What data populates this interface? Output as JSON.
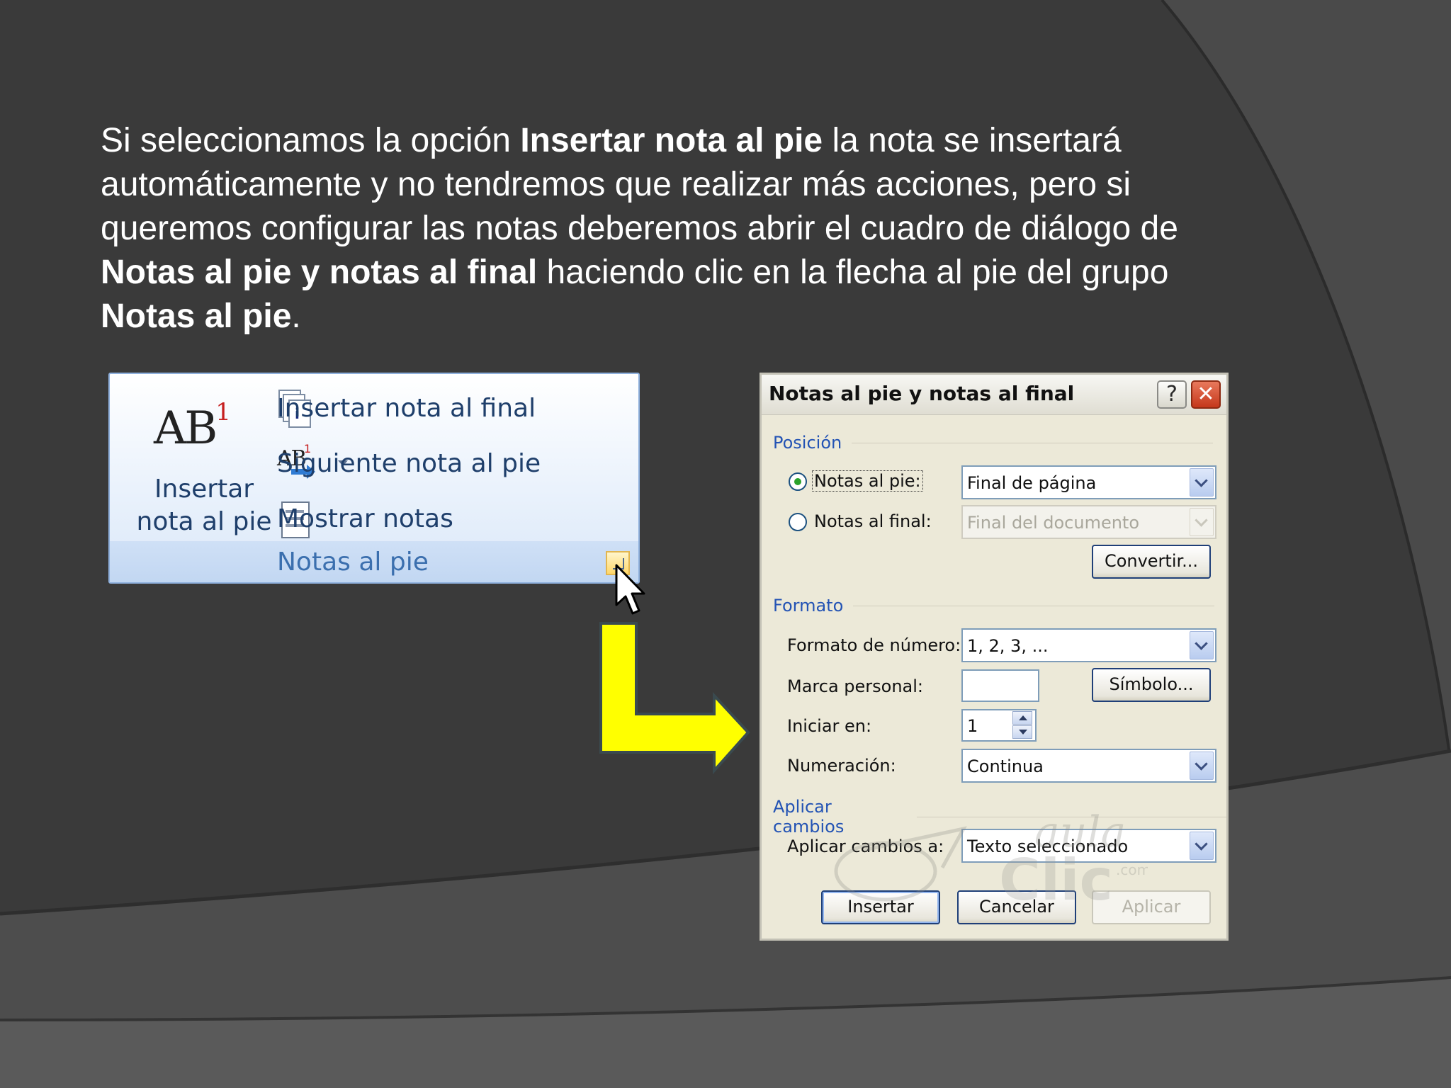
{
  "paragraph": {
    "p1": " Si seleccionamos la opción ",
    "b1": "Insertar nota al pie",
    "p2": " la nota se insertará automáticamente y no tendremos que realizar más acciones, pero si queremos configurar las notas deberemos abrir el cuadro de diálogo de ",
    "b2": "Notas al pie y notas al final",
    "p3": " haciendo clic en la flecha al pie del grupo ",
    "b3": "Notas al pie",
    "p4": "."
  },
  "ribbon": {
    "big_button": {
      "icon_text": "AB",
      "icon_sup": "1",
      "label_line1": "Insertar",
      "label_line2": "nota al pie"
    },
    "items": [
      {
        "label": "Insertar nota al final",
        "icon": "insert-endnote-icon"
      },
      {
        "label": "Siguiente nota al pie",
        "icon": "next-footnote-icon",
        "icon_text": "AB",
        "icon_sup": "1"
      },
      {
        "label": "Mostrar notas",
        "icon": "show-notes-icon"
      }
    ],
    "group_label": "Notas al pie",
    "launcher_icon": "dialog-launcher-icon"
  },
  "dialog": {
    "title": "Notas al pie y notas al final",
    "help_glyph": "?",
    "close_glyph": "✕",
    "section_position": "Posición",
    "radio_footnotes": "Notas al pie:",
    "radio_endnotes": "Notas al final:",
    "footnote_location": "Final de página",
    "endnote_location": "Final del documento",
    "convert_button": "Convertir...",
    "section_format": "Formato",
    "number_format_label": "Formato de número:",
    "number_format_value": "1, 2, 3, ...",
    "custom_mark_label": "Marca personal:",
    "custom_mark_value": "",
    "symbol_button": "Símbolo...",
    "start_at_label": "Iniciar en:",
    "start_at_value": "1",
    "numbering_label": "Numeración:",
    "numbering_value": "Continua",
    "section_apply": "Aplicar cambios",
    "apply_to_label": "Aplicar cambios a:",
    "apply_to_value": "Texto seleccionado",
    "insert_button": "Insertar",
    "cancel_button": "Cancelar",
    "apply_button": "Aplicar"
  },
  "watermark": {
    "line1": "aula",
    "line2": "Clic",
    "line3": ".com"
  },
  "colors": {
    "background": "#3a3a3a",
    "arrow_fill": "#ffff00",
    "link_blue": "#2353b4",
    "ribbon_text": "#1f3f6b"
  }
}
